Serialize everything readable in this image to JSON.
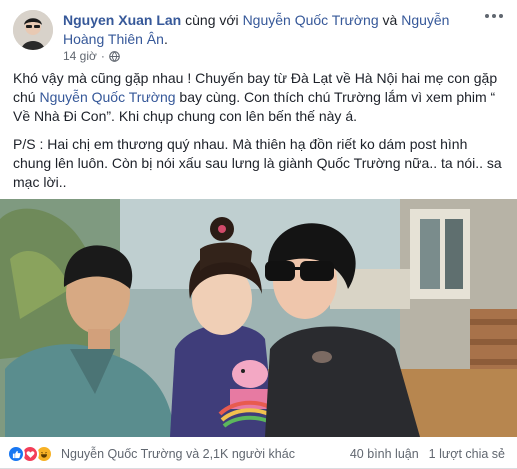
{
  "post": {
    "author": "Nguyen Xuan Lan",
    "with_text": " cùng với ",
    "tag_1": "Nguyễn Quốc Trường",
    "and_text": " và ",
    "tag_2": "Nguyễn Hoàng Thiên Ân",
    "end_dot": ".",
    "time": "14 giờ",
    "time_sep": "·",
    "privacy_icon": "globe-icon",
    "more_icon": "more-options-icon"
  },
  "body": {
    "para1_a": "Khó vậy mà cũng gặp nhau ! Chuyến bay từ Đà Lạt về Hà Nội hai mẹ con gặp chú ",
    "para1_mention": "Nguyễn Quốc Trường",
    "para1_b": " bay cùng. Con thích chú Trường lắm vì xem phim “ Về Nhà Đi Con”. Khi chụp chung con lên bến thế này á.",
    "para2": "P/S : Hai chị em thương quý nhau. Mà thiên hạ đồn riết ko dám post hình chung lên luôn. Còn bị nói xấu sau lưng là giành Quốc Trường nữa.. ta nói.. sa mạc lời.."
  },
  "photo": {
    "alt_icon": "photo-image"
  },
  "footer": {
    "reactions": [
      "like-icon",
      "love-icon",
      "haha-icon"
    ],
    "reaction_text": "Nguyễn Quốc Trường và 2,1K người khác",
    "comments": "40 bình luận",
    "shares": "1 lượt chia sẻ"
  },
  "colors": {
    "link": "#365899",
    "meta": "#616770",
    "like": "#1877f2",
    "love": "#f33e58",
    "haha": "#f7b125"
  }
}
